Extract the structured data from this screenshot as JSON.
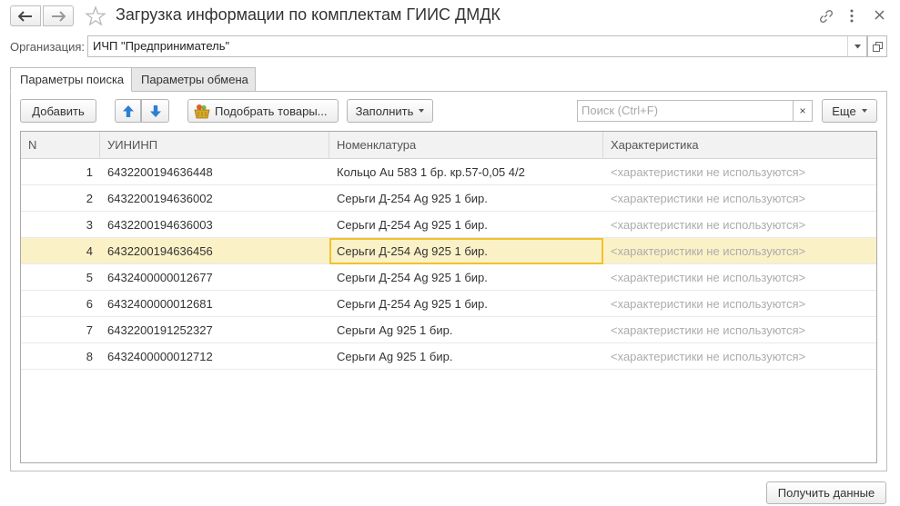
{
  "window": {
    "title": "Загрузка информации по комплектам ГИИС ДМДК",
    "icons": [
      "back-arrow-icon",
      "forward-arrow-icon",
      "star-icon",
      "link-icon",
      "more-icon",
      "close-icon"
    ]
  },
  "organization": {
    "label": "Организация:",
    "value": "ИЧП \"Предприниматель\""
  },
  "tabs": [
    {
      "label": "Параметры поиска",
      "active": true
    },
    {
      "label": "Параметры обмена",
      "active": false
    }
  ],
  "toolbar": {
    "add_label": "Добавить",
    "pick_goods_label": "Подобрать товары...",
    "fill_label": "Заполнить",
    "more_label": "Еще"
  },
  "search": {
    "placeholder": "Поиск (Ctrl+F)",
    "clear_glyph": "×"
  },
  "table": {
    "columns": [
      "N",
      "УИНИНП",
      "Номенклатура",
      "Характеристика"
    ],
    "rows": [
      {
        "n": "1",
        "uin": "6432200194636448",
        "nom": "Кольцо Au 583 1 бр. кр.57-0,05 4/2",
        "char": "<характеристики не используются>"
      },
      {
        "n": "2",
        "uin": "6432200194636002",
        "nom": "Серьги Д-254 Ag 925 1 бир.",
        "char": "<характеристики не используются>"
      },
      {
        "n": "3",
        "uin": "6432200194636003",
        "nom": "Серьги Д-254 Ag 925 1 бир.",
        "char": "<характеристики не используются>"
      },
      {
        "n": "4",
        "uin": "6432200194636456",
        "nom": "Серьги Д-254 Ag 925 1 бир.",
        "char": "<характеристики не используются>"
      },
      {
        "n": "5",
        "uin": "6432400000012677",
        "nom": "Серьги Д-254 Ag 925 1 бир.",
        "char": "<характеристики не используются>"
      },
      {
        "n": "6",
        "uin": "6432400000012681",
        "nom": "Серьги Д-254 Ag 925 1 бир.",
        "char": "<характеристики не используются>"
      },
      {
        "n": "7",
        "uin": "6432200191252327",
        "nom": "Серьги Ag 925 1 бир.",
        "char": "<характеристики не используются>"
      },
      {
        "n": "8",
        "uin": "6432400000012712",
        "nom": "Серьги Ag 925 1 бир.",
        "char": "<характеристики не используются>"
      }
    ],
    "selected_row": 4
  },
  "footer": {
    "get_data_label": "Получить данные"
  },
  "colors": {
    "selected_row": "#fbf1c7",
    "focus_border": "#f0c22e",
    "arrow_blue": "#2e7fd3"
  }
}
